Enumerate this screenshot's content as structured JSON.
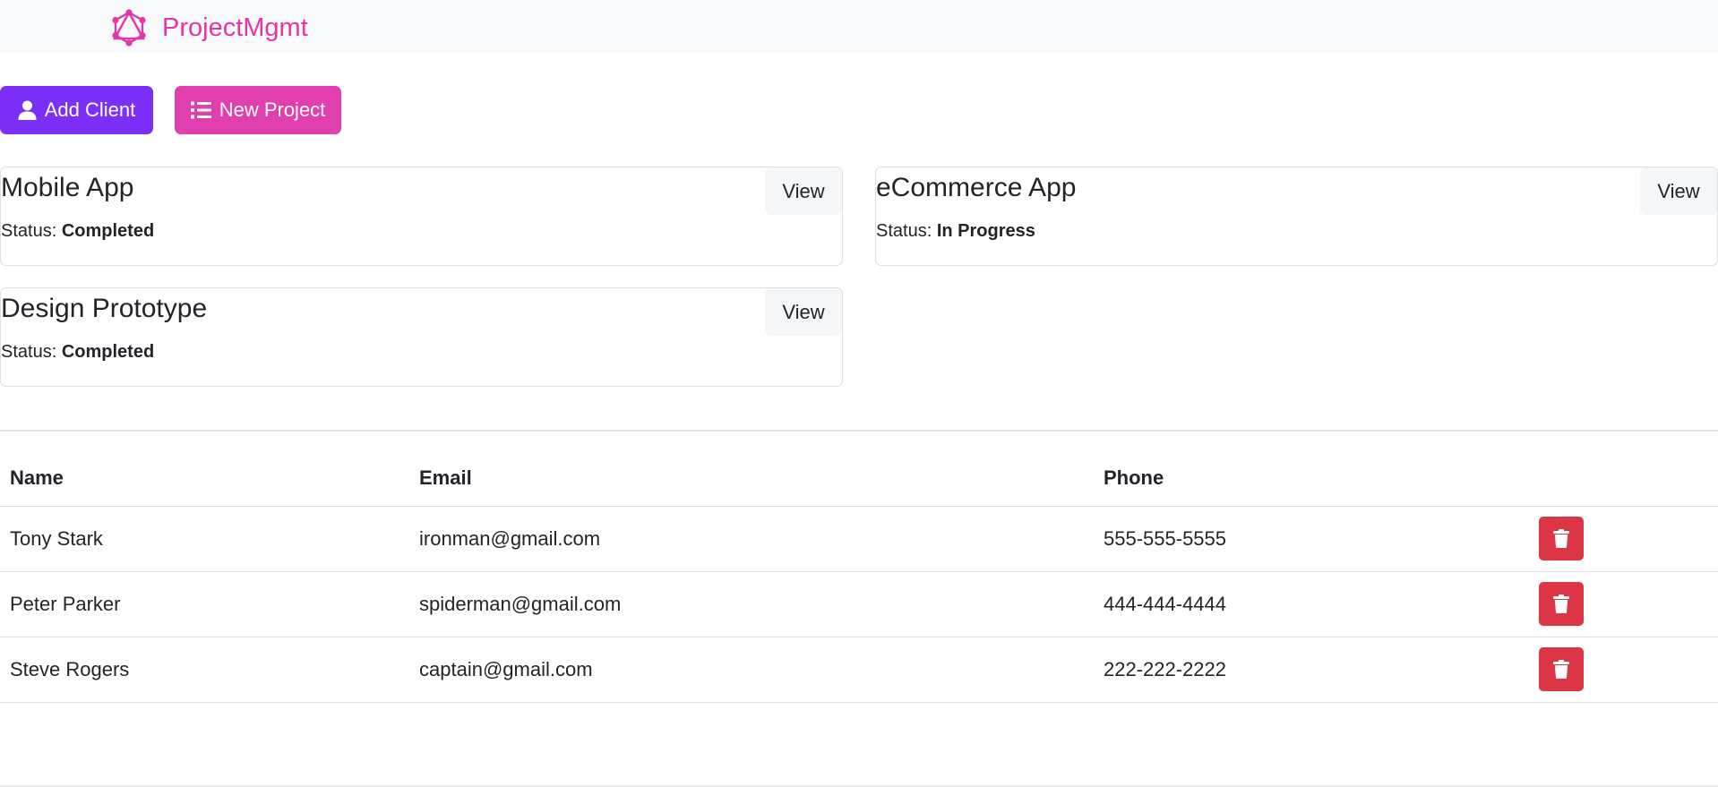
{
  "navbar": {
    "brand": "ProjectMgmt",
    "logo_icon": "graphql-logo-icon",
    "brand_color": "#e535ab"
  },
  "actions": {
    "add_client": {
      "label": "Add Client",
      "icon": "user-icon",
      "color": "#7b2ff7"
    },
    "new_project": {
      "label": "New Project",
      "icon": "list-icon",
      "color": "#e13fad"
    }
  },
  "projects": [
    {
      "name": "Mobile App",
      "status_label": "Status:",
      "status": "Completed",
      "view_label": "View"
    },
    {
      "name": "eCommerce App",
      "status_label": "Status:",
      "status": "In Progress",
      "view_label": "View"
    },
    {
      "name": "Design Prototype",
      "status_label": "Status:",
      "status": "Completed",
      "view_label": "View"
    }
  ],
  "clients_table": {
    "headers": [
      "Name",
      "Email",
      "Phone"
    ],
    "rows": [
      {
        "name": "Tony Stark",
        "email": "ironman@gmail.com",
        "phone": "555-555-5555"
      },
      {
        "name": "Peter Parker",
        "email": "spiderman@gmail.com",
        "phone": "444-444-4444"
      },
      {
        "name": "Steve Rogers",
        "email": "captain@gmail.com",
        "phone": "222-222-2222"
      }
    ],
    "delete_icon": "trash-icon",
    "delete_color": "#dc3545"
  }
}
